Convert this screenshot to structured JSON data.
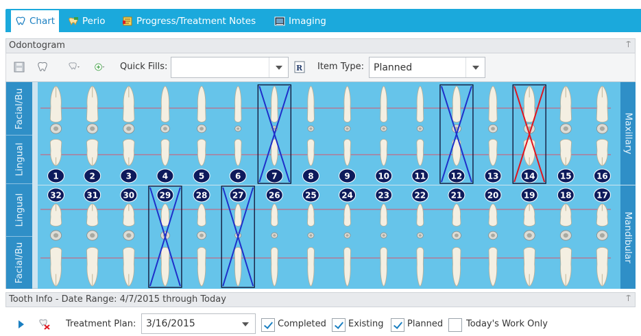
{
  "tabs": [
    {
      "label": "Chart",
      "icon": "tooth-icon",
      "active": true
    },
    {
      "label": "Perio",
      "icon": "perio-icon",
      "active": false
    },
    {
      "label": "Progress/Treatment Notes",
      "icon": "notes-icon",
      "active": false
    },
    {
      "label": "Imaging",
      "icon": "imaging-icon",
      "active": false
    }
  ],
  "odontogram": {
    "title": "Odontogram",
    "pin": "⍑",
    "toolbar": {
      "quick_fills_label": "Quick Fills:",
      "quick_fills_value": "",
      "item_type_label": "Item Type:",
      "item_type_value": "Planned"
    },
    "side_labels": {
      "left_upper_facial": "Facial/Bu",
      "left_upper_lingual": "Lingual",
      "left_lower_lingual": "Lingual",
      "left_lower_facial": "Facial/Bu",
      "right_upper": "Maxillary",
      "right_lower": "Mandibular"
    },
    "upper_teeth": [
      "1",
      "2",
      "3",
      "4",
      "5",
      "6",
      "7",
      "8",
      "9",
      "10",
      "11",
      "12",
      "13",
      "14",
      "15",
      "16"
    ],
    "lower_teeth": [
      "32",
      "31",
      "30",
      "29",
      "28",
      "27",
      "26",
      "25",
      "24",
      "23",
      "22",
      "21",
      "20",
      "19",
      "18",
      "17"
    ],
    "marked_blue": [
      "7",
      "12",
      "29",
      "27"
    ],
    "marked_red": [
      "14"
    ],
    "colors": {
      "accent": "#1ba9dc",
      "jaw_bg": "#66c4ea",
      "side_bar": "#2f8fc7",
      "badge": "#0d1a5b",
      "mark_blue": "#1e2fc9",
      "mark_red": "#e0141e"
    }
  },
  "tooth_info": {
    "title": "Tooth Info - Date Range: 4/7/2015 through Today",
    "pin": "⍑",
    "treatment_plan_label": "Treatment Plan:",
    "treatment_plan_value": "3/16/2015",
    "filters": [
      {
        "label": "Completed",
        "checked": true
      },
      {
        "label": "Existing",
        "checked": true
      },
      {
        "label": "Planned",
        "checked": true
      },
      {
        "label": "Today's Work Only",
        "checked": false
      }
    ]
  }
}
